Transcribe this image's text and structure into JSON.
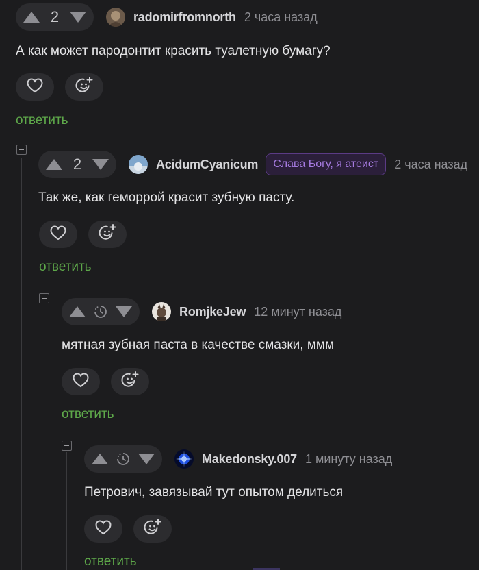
{
  "comments": [
    {
      "rating": "2",
      "username": "radomirfromnorth",
      "time": "2 часа назад",
      "text": "А как может пародонтит красить туалетную бумагу?",
      "reply": "ответить"
    },
    {
      "rating": "2",
      "username": "AcidumCyanicum",
      "badge": "Слава Богу, я атеист",
      "time": "2 часа назад",
      "text": "Так же, как геморрой красит зубную пасту.",
      "reply": "ответить"
    },
    {
      "username": "RomjkeJew",
      "time": "12 минут назад",
      "text": "мятная зубная паста в качестве смазки, ммм",
      "reply": "ответить"
    },
    {
      "username": "Makedonsky.007",
      "time": "1 минуту назад",
      "text": "Петрович, завязывай тут опытом делиться",
      "reply": "ответить"
    }
  ],
  "colors": {
    "background": "#1c1c1e",
    "reply_link": "#5ea84a",
    "badge_text": "#a67be0"
  },
  "icons": [
    "arrow-up-icon",
    "arrow-down-icon",
    "timer-icon",
    "heart-icon",
    "emoji-add-icon",
    "collapse-icon"
  ]
}
